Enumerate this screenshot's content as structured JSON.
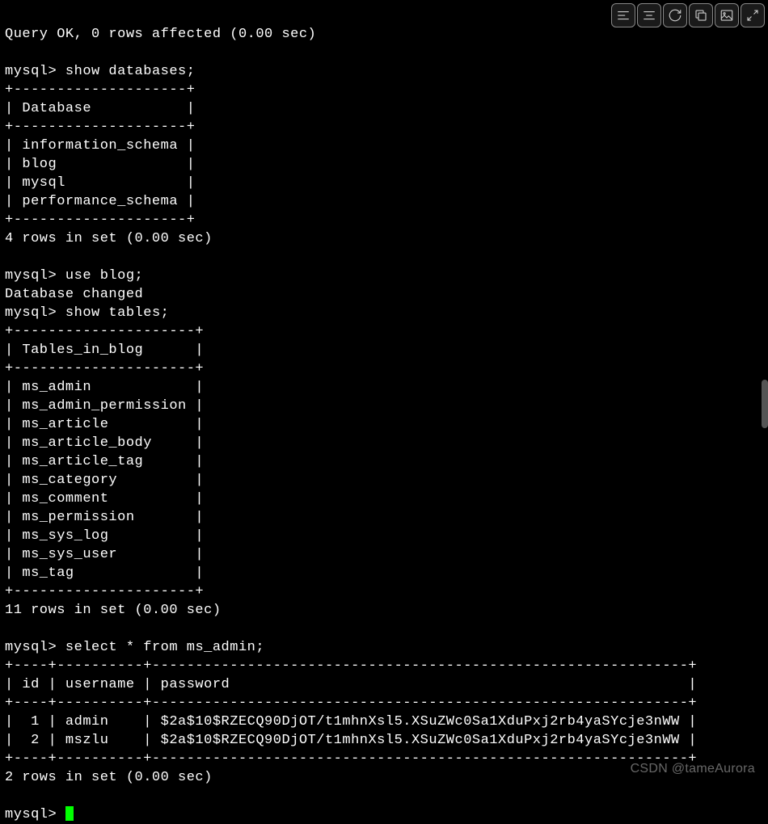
{
  "terminal": {
    "query_ok": "Query OK, 0 rows affected (0.00 sec)",
    "prompt": "mysql> ",
    "cmd_show_db": "show databases;",
    "db_sep": "+--------------------+",
    "db_header": "| Database           |",
    "db_rows": {
      "r1": "| information_schema |",
      "r2": "| blog               |",
      "r3": "| mysql              |",
      "r4": "| performance_schema |"
    },
    "db_count": "4 rows in set (0.00 sec)",
    "cmd_use_blog": "use blog;",
    "db_changed": "Database changed",
    "cmd_show_tables": "show tables;",
    "tbl_sep": "+---------------------+",
    "tbl_header": "| Tables_in_blog      |",
    "tbl_rows": {
      "r1": "| ms_admin            |",
      "r2": "| ms_admin_permission |",
      "r3": "| ms_article          |",
      "r4": "| ms_article_body     |",
      "r5": "| ms_article_tag      |",
      "r6": "| ms_category         |",
      "r7": "| ms_comment          |",
      "r8": "| ms_permission       |",
      "r9": "| ms_sys_log          |",
      "r10": "| ms_sys_user         |",
      "r11": "| ms_tag              |"
    },
    "tbl_count": "11 rows in set (0.00 sec)",
    "cmd_select": "select * from ms_admin;",
    "adm_sep": "+----+----------+--------------------------------------------------------------+",
    "adm_header": "| id | username | password                                                     |",
    "adm_rows": {
      "r1": "|  1 | admin    | $2a$10$RZECQ90DjOT/t1mhnXsl5.XSuZWc0Sa1XduPxj2rb4yaSYcje3nWW |",
      "r2": "|  2 | mszlu    | $2a$10$RZECQ90DjOT/t1mhnXsl5.XSuZWc0Sa1XduPxj2rb4yaSYcje3nWW |"
    },
    "adm_count": "2 rows in set (0.00 sec)"
  },
  "watermark": "CSDN @tameAurora",
  "toolbar_icons": {
    "i1": "align-left-icon",
    "i2": "align-center-icon",
    "i3": "refresh-icon",
    "i4": "copy-icon",
    "i5": "image-icon",
    "i6": "expand-icon"
  }
}
